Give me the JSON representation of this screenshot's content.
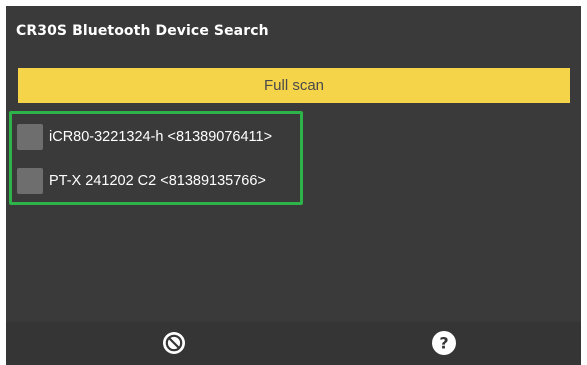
{
  "window": {
    "title": "CR30S Bluetooth Device Search"
  },
  "scan": {
    "button_label": "Full scan"
  },
  "devices": [
    {
      "label": "iCR80-3221324-h <81389076411>",
      "checked": false
    },
    {
      "label": "PT-X 241202 C2 <81389135766>",
      "checked": false
    }
  ],
  "bottom_bar": {
    "left_icon": "cancel-icon",
    "right_icon": "help-icon"
  },
  "colors": {
    "background": "#3a3a3a",
    "accent": "#f6d44a",
    "highlight": "#2db34a",
    "checkbox": "#6e6e6e",
    "text": "#ffffff"
  }
}
